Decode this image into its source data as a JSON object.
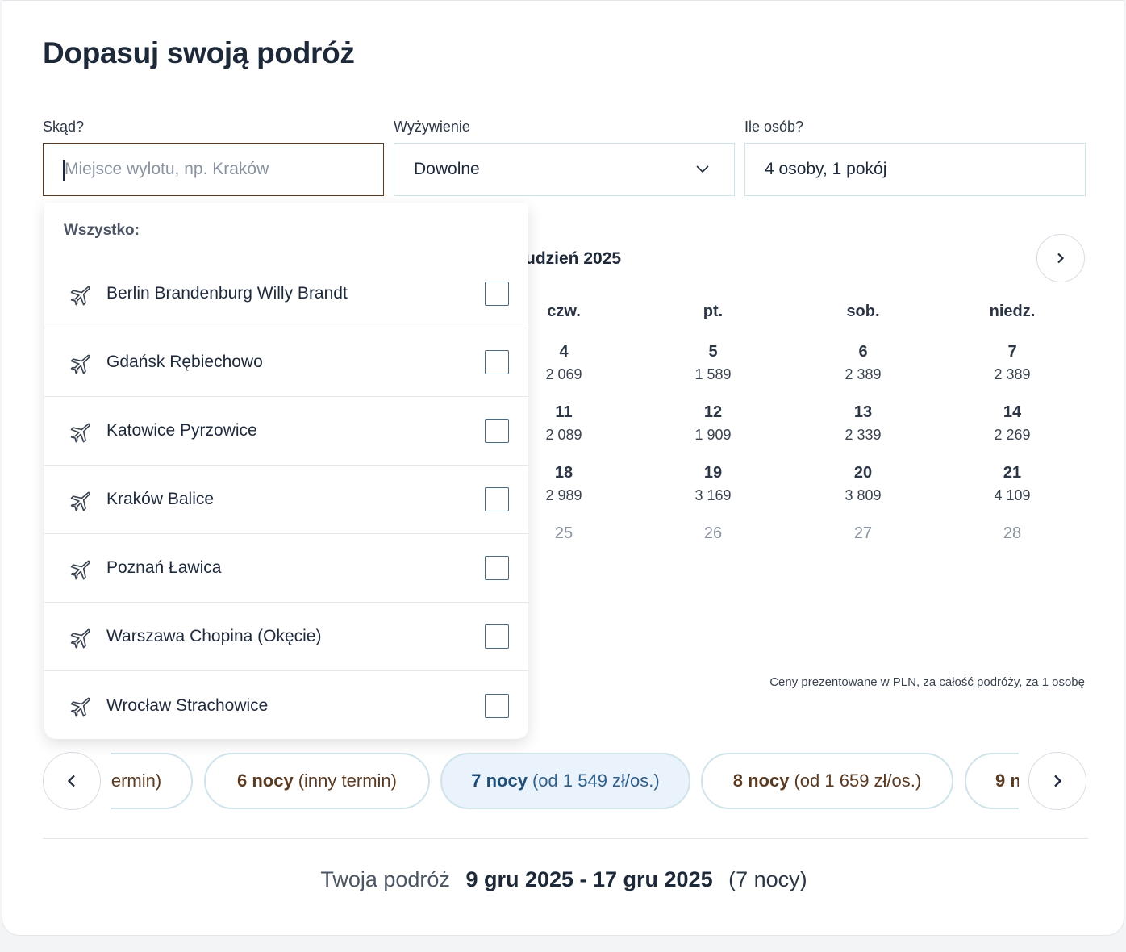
{
  "title": "Dopasuj swoją podróż",
  "fields": {
    "from": {
      "label": "Skąd?",
      "placeholder": "Miejsce wylotu, np. Kraków",
      "value": ""
    },
    "board": {
      "label": "Wyżywienie",
      "value": "Dowolne"
    },
    "people": {
      "label": "Ile osób?",
      "value": "4 osoby, 1 pokój"
    }
  },
  "dropdown": {
    "heading": "Wszystko:",
    "items": [
      {
        "label": "Berlin Brandenburg Willy Brandt",
        "checked": false,
        "icon": "plane-icon"
      },
      {
        "label": "Gdańsk Rębiechowo",
        "checked": false,
        "icon": "plane-icon"
      },
      {
        "label": "Katowice Pyrzowice",
        "checked": false,
        "icon": "plane-icon"
      },
      {
        "label": "Kraków Balice",
        "checked": false,
        "icon": "plane-icon"
      },
      {
        "label": "Poznań Ławica",
        "checked": false,
        "icon": "plane-icon"
      },
      {
        "label": "Warszawa Chopina (Okęcie)",
        "checked": false,
        "icon": "plane-icon"
      },
      {
        "label": "Wrocław Strachowice",
        "checked": false,
        "icon": "plane-icon"
      }
    ]
  },
  "calendar": {
    "month": "udzień 2025",
    "weekdays": [
      "czw.",
      "pt.",
      "sob.",
      "niedz."
    ],
    "weeks": [
      [
        {
          "day": "4",
          "price": "2 069"
        },
        {
          "day": "5",
          "price": "1 589"
        },
        {
          "day": "6",
          "price": "2 389"
        },
        {
          "day": "7",
          "price": "2 389"
        }
      ],
      [
        {
          "day": "11",
          "price": "2 089"
        },
        {
          "day": "12",
          "price": "1 909"
        },
        {
          "day": "13",
          "price": "2 339"
        },
        {
          "day": "14",
          "price": "2 269"
        }
      ],
      [
        {
          "day": "18",
          "price": "2 989"
        },
        {
          "day": "19",
          "price": "3 169"
        },
        {
          "day": "20",
          "price": "3 809"
        },
        {
          "day": "21",
          "price": "4 109"
        }
      ],
      [
        {
          "day": "25",
          "price": ""
        },
        {
          "day": "26",
          "price": ""
        },
        {
          "day": "27",
          "price": ""
        },
        {
          "day": "28",
          "price": ""
        }
      ]
    ],
    "note": "Ceny prezentowane w PLN, za całość podróży, za 1 osobę"
  },
  "nights": [
    {
      "bold": "",
      "sub": "ermin)",
      "selected": false
    },
    {
      "bold": "6 nocy",
      "sub": "(inny termin)",
      "selected": false
    },
    {
      "bold": "7 nocy",
      "sub": "(od 1 549 zł/os.)",
      "selected": true
    },
    {
      "bold": "8 nocy",
      "sub": "(od 1 659 zł/os.)",
      "selected": false
    },
    {
      "bold": "9 n",
      "sub": "",
      "selected": false
    }
  ],
  "summary": {
    "label": "Twoja podróż",
    "dates": "9 gru 2025 - 17 gru 2025",
    "nights": "(7 nocy)"
  },
  "colors": {
    "accent_brown": "#5b3a22",
    "selected_blue": "#1f4e79",
    "border": "#cfe3ea"
  }
}
